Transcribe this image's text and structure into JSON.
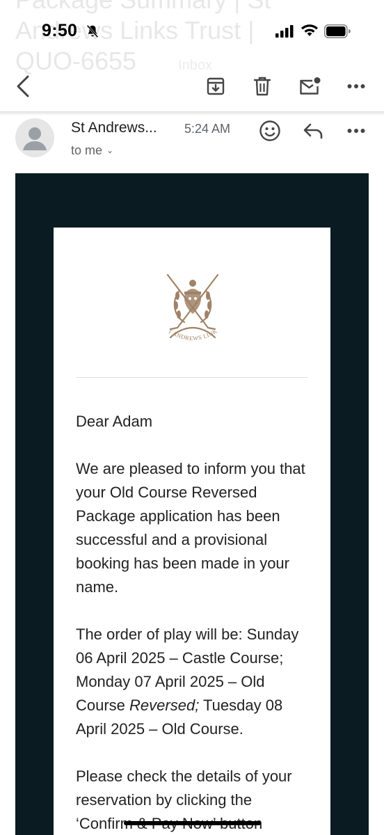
{
  "background_subject": {
    "line1": "Package Summary | St",
    "line2": "Andrews Links Trust |",
    "line3": "QUO-6655",
    "label": "Inbox"
  },
  "status_bar": {
    "time": "9:50"
  },
  "sender": {
    "name": "St Andrews...",
    "time": "5:24 AM",
    "recipient": "to me"
  },
  "email": {
    "crest_text": "ST ANDREWS LINKS",
    "greeting": "Dear Adam",
    "p1": "We are pleased to inform you that your Old Course Reversed Package application has been successful and a provisional booking has been made in your name.",
    "p2_a": "The order of play will be: Sunday 06 April 2025 – Castle Course; Monday 07 April 2025 – Old Course ",
    "p2_b": "Reversed;",
    "p2_c": " Tuesday 08 April 2025 – Old Course.",
    "p3": "Please check the details of your reservation by clicking the ‘Confirm & Pay Now’ button"
  },
  "colors": {
    "frame": "#0b1b22",
    "crest": "#a08266"
  }
}
